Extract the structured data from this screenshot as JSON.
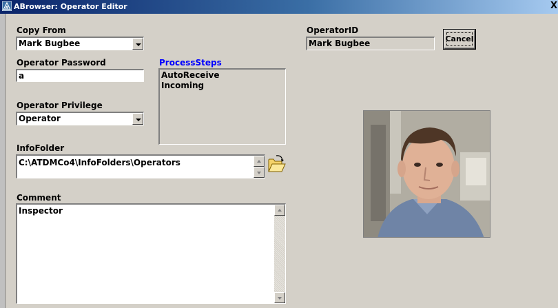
{
  "window": {
    "title": "ABrowser: Operator Editor",
    "close_glyph": "X",
    "app_icon": "abrowser-logo-icon"
  },
  "form": {
    "copy_from": {
      "label": "Copy From",
      "value": "Mark Bugbee"
    },
    "operator_password": {
      "label": "Operator Password",
      "value": "a"
    },
    "operator_privilege": {
      "label": "Operator Privilege",
      "value": "Operator"
    },
    "process_steps": {
      "label": "ProcessSteps",
      "items": [
        "AutoReceive",
        "Incoming"
      ]
    },
    "info_folder": {
      "label": "InfoFolder",
      "value": "C:\\ATDMCo4\\InfoFolders\\Operators",
      "browse_icon": "open-folder-icon"
    },
    "comment": {
      "label": "Comment",
      "value": "Inspector"
    },
    "operator_id": {
      "label": "OperatorID",
      "value": "Mark Bugbee"
    },
    "cancel_label": "Cancel"
  },
  "colors": {
    "window_bg": "#d4d0c8",
    "titlebar_start": "#0a246a",
    "titlebar_end": "#a6caf0",
    "process_steps_label": "#0000ff"
  }
}
